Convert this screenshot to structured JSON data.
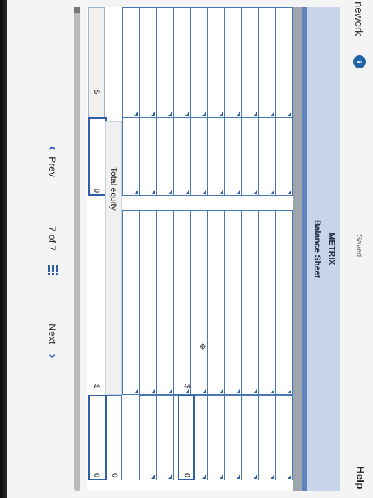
{
  "header": {
    "title_partial": "nework",
    "info_glyph": "i",
    "status": "Saved",
    "help_label": "Help"
  },
  "statement": {
    "company": "METRIX",
    "title": "Balance Sheet"
  },
  "rows": {
    "total_equity_label": "Total equity"
  },
  "totals": {
    "left_currency": "$",
    "left_value": "0",
    "right_currency": "$",
    "right_mid_value": "0",
    "right_bottom_currency": "$",
    "right_bottom_value": "0",
    "equity_value": "0"
  },
  "navigation": {
    "prev_label": "Prev",
    "page_current": "7",
    "page_of": "of",
    "page_total": "7",
    "next_label": "Next"
  },
  "colors": {
    "accent": "#2f5fa5",
    "title_band": "#c8d5e9"
  }
}
